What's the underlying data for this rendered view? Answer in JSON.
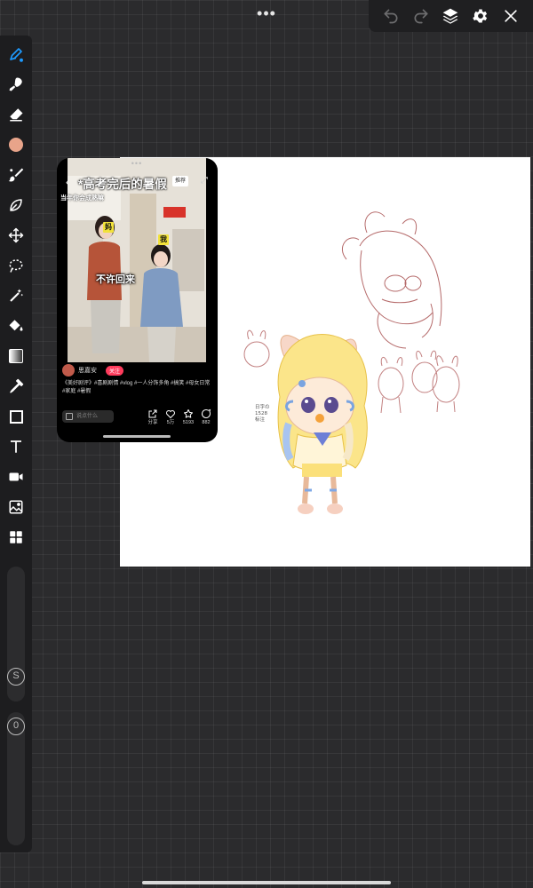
{
  "app": {
    "menu_dots": "•••",
    "toolbar": {
      "undo": "undo-icon",
      "redo": "redo-icon",
      "layers": "layers-icon",
      "settings": "gear-icon",
      "close": "close-icon"
    },
    "color_accent": "#1e9bff",
    "current_color": "#e8a48a"
  },
  "tools": [
    {
      "name": "pen-tool",
      "icon": "pen-icon",
      "active": true
    },
    {
      "name": "smudge-tool",
      "icon": "smudge-icon"
    },
    {
      "name": "eraser-tool",
      "icon": "eraser-icon"
    },
    {
      "name": "color-tool",
      "icon": "color-swatch-icon"
    },
    {
      "name": "brush-tool",
      "icon": "brush-icon"
    },
    {
      "name": "blend-tool",
      "icon": "leaf-icon"
    },
    {
      "name": "transform-tool",
      "icon": "move-arrows-icon"
    },
    {
      "name": "lasso-tool",
      "icon": "lasso-icon"
    },
    {
      "name": "magic-wand-tool",
      "icon": "magic-wand-icon"
    },
    {
      "name": "fill-tool",
      "icon": "paint-bucket-icon"
    },
    {
      "name": "gradient-tool",
      "icon": "gradient-icon"
    },
    {
      "name": "eyedropper-tool",
      "icon": "eyedropper-icon"
    },
    {
      "name": "shape-tool",
      "icon": "square-icon"
    },
    {
      "name": "text-tool",
      "icon": "text-icon"
    },
    {
      "name": "video-tool",
      "icon": "video-camera-icon"
    },
    {
      "name": "image-tool",
      "icon": "image-icon"
    },
    {
      "name": "more-tools",
      "icon": "grid-icon"
    }
  ],
  "sliders": {
    "size_label": "S",
    "opacity_label": "0"
  },
  "video": {
    "title": "*高考完后的暑假",
    "tag": "推荐",
    "subtitle": "当年你会成熟嘛",
    "badge_left": "妈",
    "badge_right": "我",
    "caption": "不许回来",
    "author": "思嘉安",
    "follow": "关注",
    "description": "《美好剧评》#喜剧剧情 #vlog #一人分饰多角 #搞笑 #母女日常 #家庭 #暑假",
    "input_placeholder": "说点什么",
    "actions": [
      {
        "icon": "share-icon",
        "count": "分享"
      },
      {
        "icon": "heart-icon",
        "count": "5万"
      },
      {
        "icon": "star-icon",
        "count": "5193"
      },
      {
        "icon": "comment-icon",
        "count": "882"
      }
    ]
  },
  "sketch": {
    "note": "日字の\n1528\n标注"
  }
}
